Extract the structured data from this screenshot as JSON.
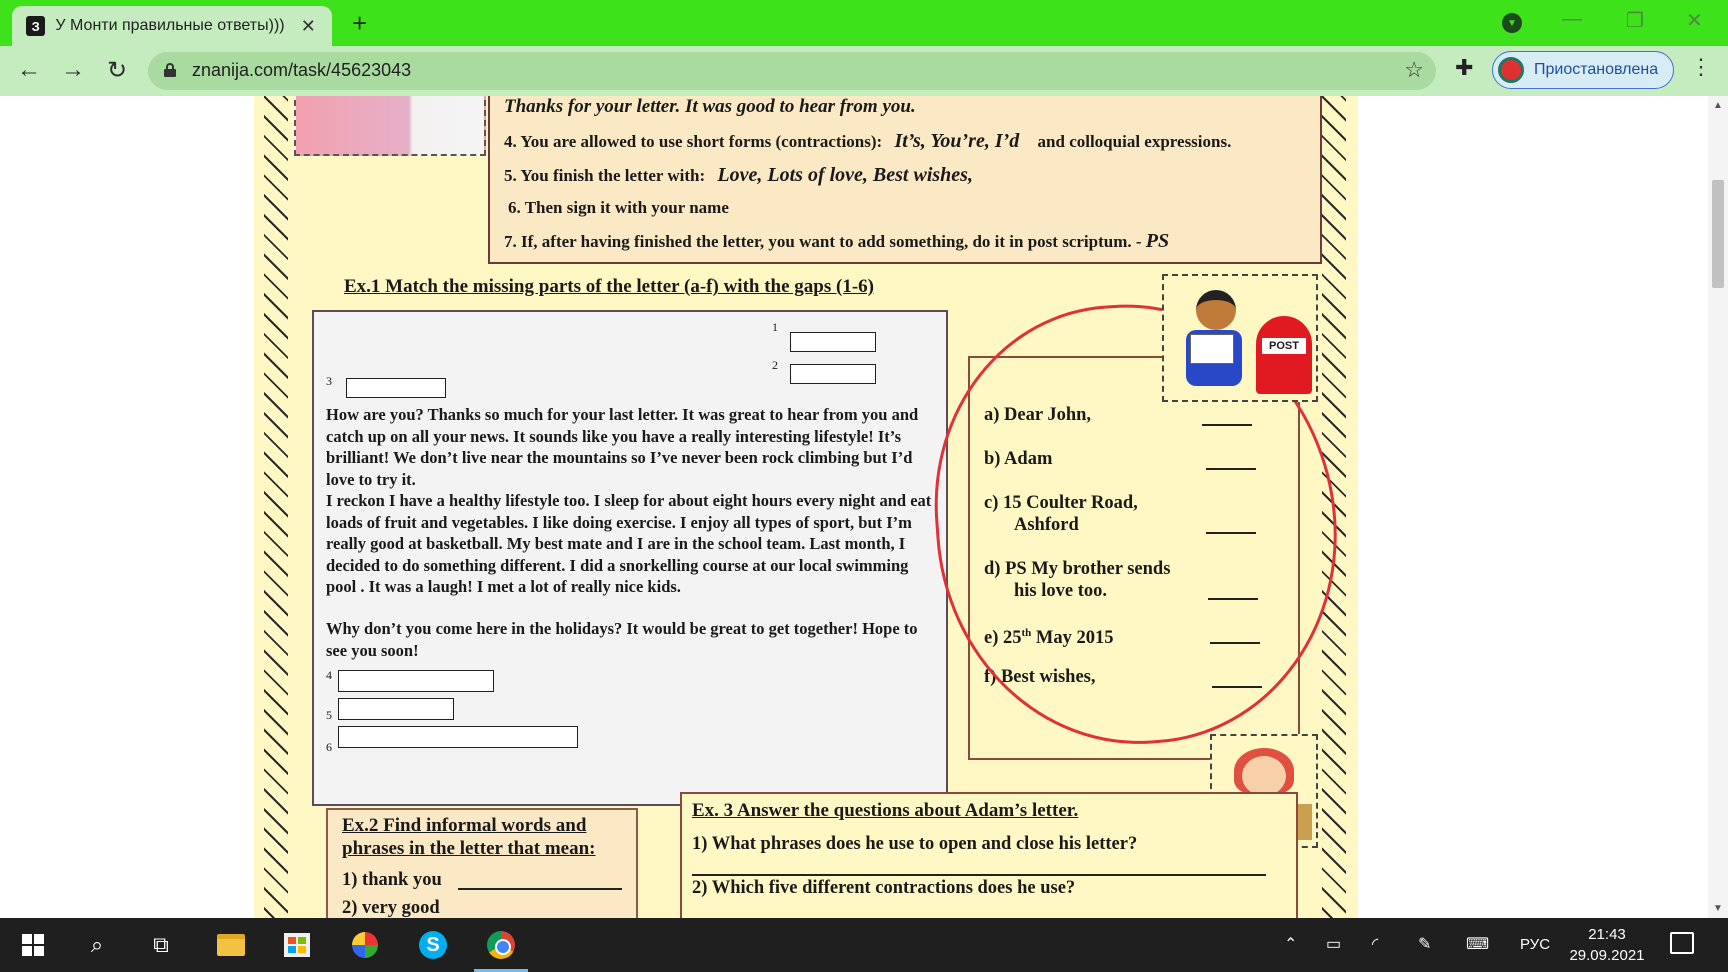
{
  "browser": {
    "tab_title": "У Монти правильные ответы)))",
    "tab_favicon": "З",
    "new_tab": "+",
    "url": "znanija.com/task/45623043",
    "profile_label": "Приостановлена",
    "accent": "#3ee21a"
  },
  "worksheet": {
    "rules": {
      "r3_phrase": "Thanks for your letter.       It was good to hear from you.",
      "r4_text": "4. You are allowed to use short forms (contractions):",
      "r4_example": "It’s, You’re, I’d",
      "r4_tail": "and colloquial expressions.",
      "r5_text": "5. You finish the letter with:",
      "r5_example": "Love, Lots of love, Best wishes,",
      "r6_text": "6. Then sign it with your name",
      "r7_text": "7. If, after having finished the letter, you want to add something, do it in post scriptum. -",
      "r7_ps": "PS"
    },
    "ex1_title": "Ex.1 Match the missing parts of the letter (a-f) with the gaps (1-6)",
    "gaps": [
      "1",
      "2",
      "3",
      "4",
      "5",
      "6"
    ],
    "letter_paragraphs": [
      "How are you? Thanks so much for your last letter. It was great to hear from you and catch up on all your news. It sounds like you have a really interesting lifestyle! It’s brilliant! We don’t live near the mountains so I’ve never been rock climbing but I’d love to try it.",
      " I reckon I have a healthy lifestyle too. I sleep for about eight hours every night and eat loads of fruit and vegetables. I like doing exercise.  I enjoy all types of sport, but I’m really good at basketball. My best mate and I are in the school team. Last month, I decided to do something different. I did a snorkelling course at our local swimming pool . It was a laugh! I met a lot of really nice kids.",
      "Why don’t you come here in the holidays? It would be great to get together! Hope to see you soon!"
    ],
    "answers": {
      "a": "a)  Dear John,",
      "b": "b)  Adam",
      "c1": "c) 15 Coulter Road,",
      "c2": "Ashford",
      "d1": "d) PS My brother sends",
      "d2": "his love too.",
      "e_pre": "e) 25",
      "e_sup": "th",
      "e_post": " May 2015",
      "f": "f) Best wishes,"
    },
    "post_label": "POST",
    "ex2_title": "Ex.2 Find informal words and phrases in the letter that mean:",
    "ex2_item1": "1) thank you",
    "ex2_item2": "2) very good",
    "ex3_title": "Ex. 3  Answer the questions about Adam’s letter.",
    "ex3_q1": "1) What phrases does he use to open and close his letter?",
    "ex3_q2": "2) Which five different contractions does he use?",
    "annotation_color": "#e03038"
  },
  "taskbar": {
    "language": "РУС",
    "time": "21:43",
    "date": "29.09.2021",
    "skype_letter": "S"
  }
}
